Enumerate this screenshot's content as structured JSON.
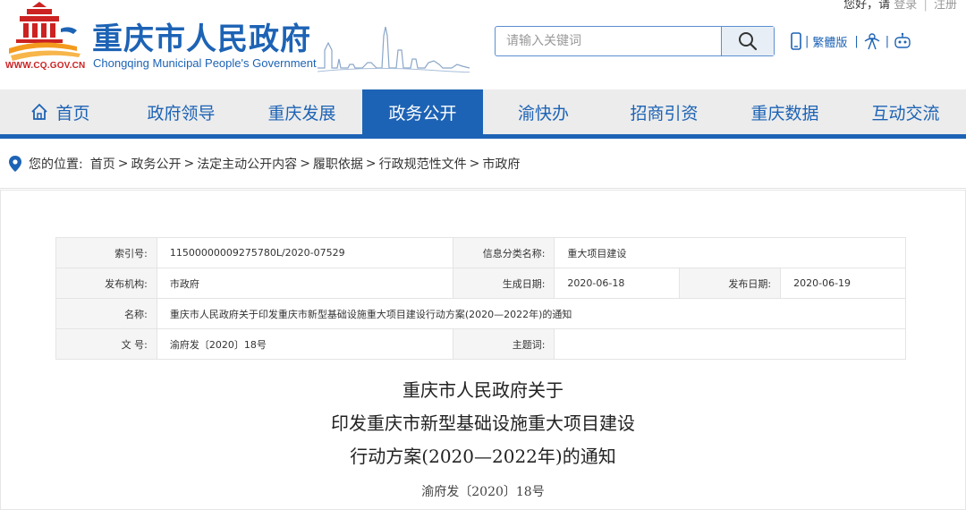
{
  "user": {
    "greeting": "您好，请",
    "login": "登录",
    "sep": "|",
    "register": "注册"
  },
  "header": {
    "site_url": "WWW.CQ.GOV.CN",
    "title": "重庆市人民政府",
    "subtitle": "Chongqing Municipal People's Government",
    "search": {
      "placeholder": "请输入关键词",
      "value": ""
    },
    "tools": {
      "traditional_label": "繁體版"
    }
  },
  "colors": {
    "brand_blue": "#1d63b5",
    "nav_bg": "#ececec",
    "logo_red": "#cc2222",
    "logo_orange": "#f39a1e"
  },
  "nav": {
    "items": [
      {
        "label": "首页",
        "icon": "home-icon"
      },
      {
        "label": "政府领导"
      },
      {
        "label": "重庆发展"
      },
      {
        "label": "政务公开",
        "active": true
      },
      {
        "label": "渝快办"
      },
      {
        "label": "招商引资"
      },
      {
        "label": "重庆数据"
      },
      {
        "label": "互动交流"
      }
    ]
  },
  "breadcrumb": {
    "prefix": "您的位置:",
    "items": [
      "首页",
      "政务公开",
      "法定主动公开内容",
      "履职依据",
      "行政规范性文件",
      "市政府"
    ],
    "separator": ">"
  },
  "info": {
    "index_label": "索引号:",
    "index_value": "11500000009275780L/2020-07529",
    "category_label": "信息分类名称:",
    "category_value": "重大项目建设",
    "issuer_label": "发布机构:",
    "issuer_value": "市政府",
    "generated_label": "生成日期:",
    "generated_value": "2020-06-18",
    "published_label": "发布日期:",
    "published_value": "2020-06-19",
    "name_label": "名称:",
    "name_value": "重庆市人民政府关于印发重庆市新型基础设施重大项目建设行动方案(2020—2022年)的通知",
    "docno_label": "文 号:",
    "docno_value": "渝府发〔2020〕18号",
    "subject_label": "主题词:",
    "subject_value": ""
  },
  "article": {
    "title_line1": "重庆市人民政府关于",
    "title_line2": "印发重庆市新型基础设施重大项目建设",
    "title_line3": "行动方案(2020—2022年)的通知",
    "doc_number": "渝府发〔2020〕18号"
  }
}
